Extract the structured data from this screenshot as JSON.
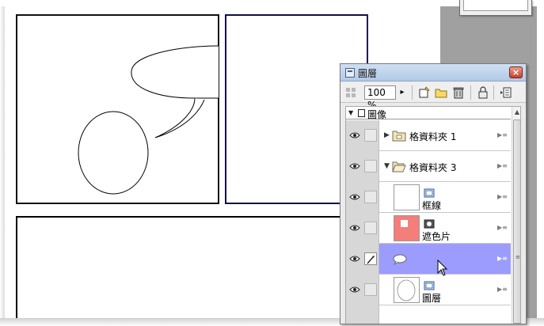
{
  "palette": {
    "title": "圖層",
    "close_glyph": "×",
    "toolbar": {
      "opacity_value": "100 %",
      "opacity_arrow": "▸"
    },
    "root_layer": "圖像",
    "layers": [
      {
        "kind": "folder",
        "name": "格資料夾 1",
        "expanded": false
      },
      {
        "kind": "folder",
        "name": "格資料夾 3",
        "expanded": true
      },
      {
        "kind": "layer",
        "name": "框線",
        "type_icon": "frame-border-icon"
      },
      {
        "kind": "layer",
        "name": "遮色片",
        "type_icon": "mask-layer-icon"
      },
      {
        "kind": "layer",
        "name": "",
        "type_icon": "balloon-layer-icon",
        "selected": true
      },
      {
        "kind": "layer",
        "name": "圖層",
        "type_icon": "raster-layer-icon"
      }
    ]
  },
  "colors": {
    "selection": "#9c9cff",
    "mask_thumb": "#f37e7a",
    "frame_border_alt": "#0f0f45"
  }
}
